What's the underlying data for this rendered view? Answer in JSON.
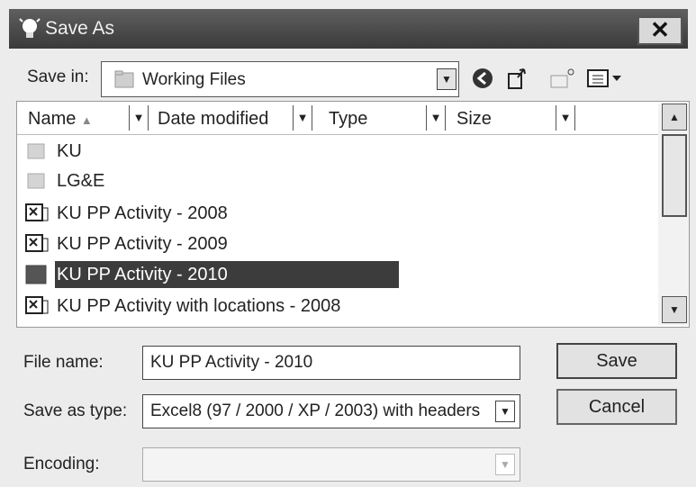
{
  "window": {
    "title": "Save As",
    "close_glyph": "✕"
  },
  "save_in": {
    "label": "Save in:",
    "value": "Working Files"
  },
  "toolbar": {
    "icons": [
      "back-icon",
      "up-folder-icon",
      "new-folder-icon",
      "view-menu-icon"
    ]
  },
  "columns": [
    "Name",
    "Date modified",
    "Type",
    "Size"
  ],
  "files": [
    {
      "name": "KU",
      "icon": "folder-icon",
      "selected": false
    },
    {
      "name": "LG&E",
      "icon": "folder-icon",
      "selected": false
    },
    {
      "name": "KU PP Activity - 2008",
      "icon": "excel-file-icon",
      "selected": false
    },
    {
      "name": "KU PP Activity - 2009",
      "icon": "excel-file-icon",
      "selected": false
    },
    {
      "name": "KU PP Activity - 2010",
      "icon": "excel-file-icon",
      "selected": true
    },
    {
      "name": "KU PP Activity with locations - 2008",
      "icon": "excel-file-icon",
      "selected": false
    }
  ],
  "form": {
    "file_name_label": "File name:",
    "file_name_value": "KU PP Activity - 2010",
    "save_type_label": "Save as type:",
    "save_type_value": "Excel8 (97 / 2000 / XP / 2003) with headers",
    "encoding_label": "Encoding:",
    "encoding_value": ""
  },
  "buttons": {
    "save": "Save",
    "cancel": "Cancel"
  }
}
